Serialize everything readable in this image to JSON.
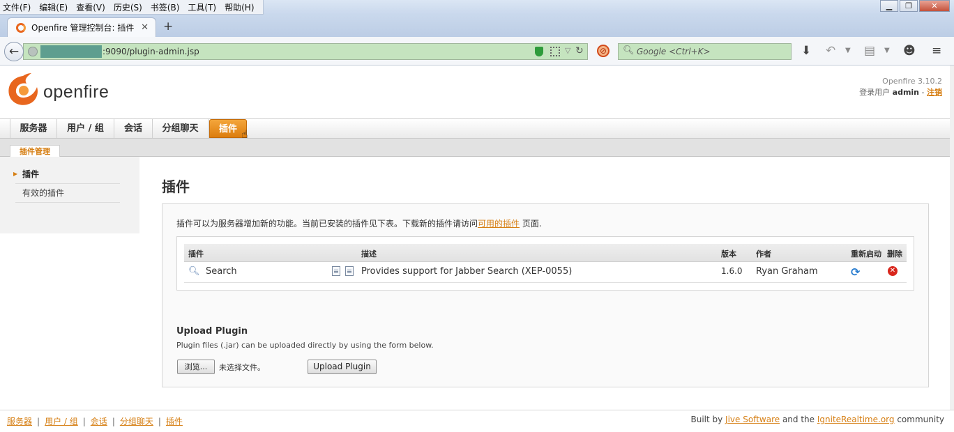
{
  "browser": {
    "menu": [
      "文件(F)",
      "编辑(E)",
      "查看(V)",
      "历史(S)",
      "书签(B)",
      "工具(T)",
      "帮助(H)"
    ],
    "tab_title": "Openfire 管理控制台: 插件",
    "url": ":9090/plugin-admin.jsp",
    "search_placeholder": "Google <Ctrl+K>"
  },
  "header": {
    "logo_text": "openfire",
    "version": "Openfire 3.10.2",
    "login_prefix": "登录用户",
    "login_user": "admin",
    "login_sep": " - ",
    "logout": "注销"
  },
  "nav": {
    "tabs": [
      "服务器",
      "用户 / 组",
      "会话",
      "分组聊天",
      "插件"
    ],
    "active_index": 4,
    "subtab": "插件管理"
  },
  "sidebar": {
    "items": [
      {
        "label": "插件",
        "active": true
      },
      {
        "label": "有效的插件",
        "active": false
      }
    ]
  },
  "main": {
    "heading": "插件",
    "intro_before": "插件可以为服务器增加新的功能。当前已安装的插件见下表。下载新的插件请访问",
    "intro_link": "可用的插件",
    "intro_after": " 页面.",
    "table": {
      "headers": [
        "插件",
        "描述",
        "版本",
        "作者",
        "重新启动",
        "删除"
      ],
      "rows": [
        {
          "name": "Search",
          "description": "Provides support for Jabber Search (XEP-0055)",
          "version": "1.6.0",
          "author": "Ryan Graham"
        }
      ]
    },
    "upload": {
      "title": "Upload Plugin",
      "description": "Plugin files (.jar) can be uploaded directly by using the form below.",
      "browse_label": "浏览...",
      "no_file": "未选择文件。",
      "upload_label": "Upload Plugin"
    }
  },
  "footer": {
    "links": [
      "服务器",
      "用户 / 组",
      "会话",
      "分组聊天",
      "插件"
    ],
    "built_prefix": "Built by ",
    "built_link1": "Jive Software",
    "built_mid": " and the ",
    "built_link2": "IgniteRealtime.org",
    "built_suffix": " community"
  },
  "colors": {
    "accent": "#d67f14",
    "url_bar_bg": "#c5e4bf"
  }
}
